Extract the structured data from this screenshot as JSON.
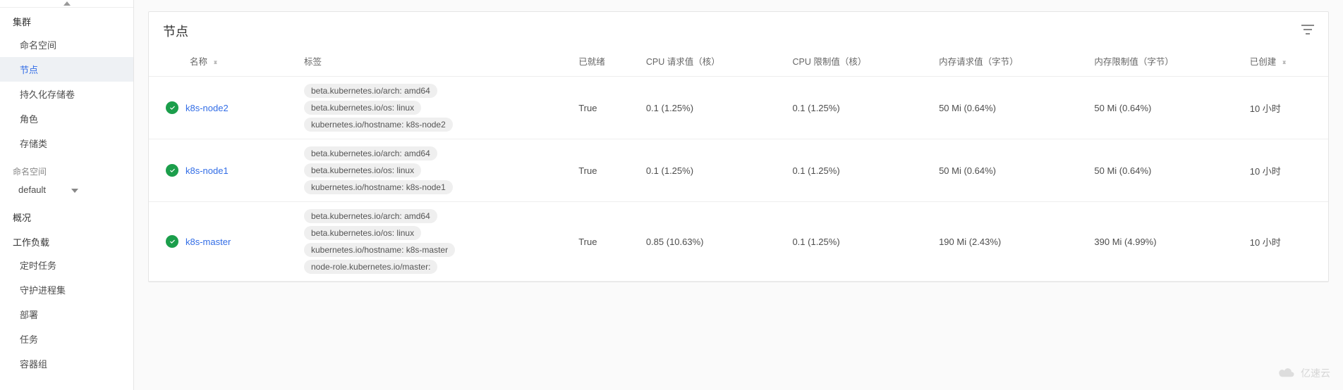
{
  "sidebar": {
    "cluster_section": "集群",
    "cluster_items": [
      {
        "label": "命名空间",
        "active": false
      },
      {
        "label": "节点",
        "active": true
      },
      {
        "label": "持久化存储卷",
        "active": false
      },
      {
        "label": "角色",
        "active": false
      },
      {
        "label": "存储类",
        "active": false
      }
    ],
    "namespace_label": "命名空间",
    "namespace_value": "default",
    "overview": "概况",
    "workload_section": "工作负载",
    "workload_items": [
      {
        "label": "定时任务"
      },
      {
        "label": "守护进程集"
      },
      {
        "label": "部署"
      },
      {
        "label": "任务"
      },
      {
        "label": "容器组"
      }
    ]
  },
  "card": {
    "title": "节点",
    "columns": {
      "name": "名称",
      "labels": "标签",
      "ready": "已就绪",
      "cpu_req": "CPU 请求值（核）",
      "cpu_lim": "CPU 限制值（核）",
      "mem_req": "内存请求值（字节）",
      "mem_lim": "内存限制值（字节）",
      "created": "已创建"
    },
    "rows": [
      {
        "name": "k8s-node2",
        "status": "ok",
        "labels": [
          "beta.kubernetes.io/arch: amd64",
          "beta.kubernetes.io/os: linux",
          "kubernetes.io/hostname: k8s-node2"
        ],
        "ready": "True",
        "cpu_req": "0.1 (1.25%)",
        "cpu_lim": "0.1 (1.25%)",
        "mem_req": "50 Mi (0.64%)",
        "mem_lim": "50 Mi (0.64%)",
        "created": "10 小时"
      },
      {
        "name": "k8s-node1",
        "status": "ok",
        "labels": [
          "beta.kubernetes.io/arch: amd64",
          "beta.kubernetes.io/os: linux",
          "kubernetes.io/hostname: k8s-node1"
        ],
        "ready": "True",
        "cpu_req": "0.1 (1.25%)",
        "cpu_lim": "0.1 (1.25%)",
        "mem_req": "50 Mi (0.64%)",
        "mem_lim": "50 Mi (0.64%)",
        "created": "10 小时"
      },
      {
        "name": "k8s-master",
        "status": "ok",
        "labels": [
          "beta.kubernetes.io/arch: amd64",
          "beta.kubernetes.io/os: linux",
          "kubernetes.io/hostname: k8s-master",
          "node-role.kubernetes.io/master:"
        ],
        "ready": "True",
        "cpu_req": "0.85 (10.63%)",
        "cpu_lim": "0.1 (1.25%)",
        "mem_req": "190 Mi (2.43%)",
        "mem_lim": "390 Mi (4.99%)",
        "created": "10 小时"
      }
    ]
  },
  "watermark": "亿速云"
}
